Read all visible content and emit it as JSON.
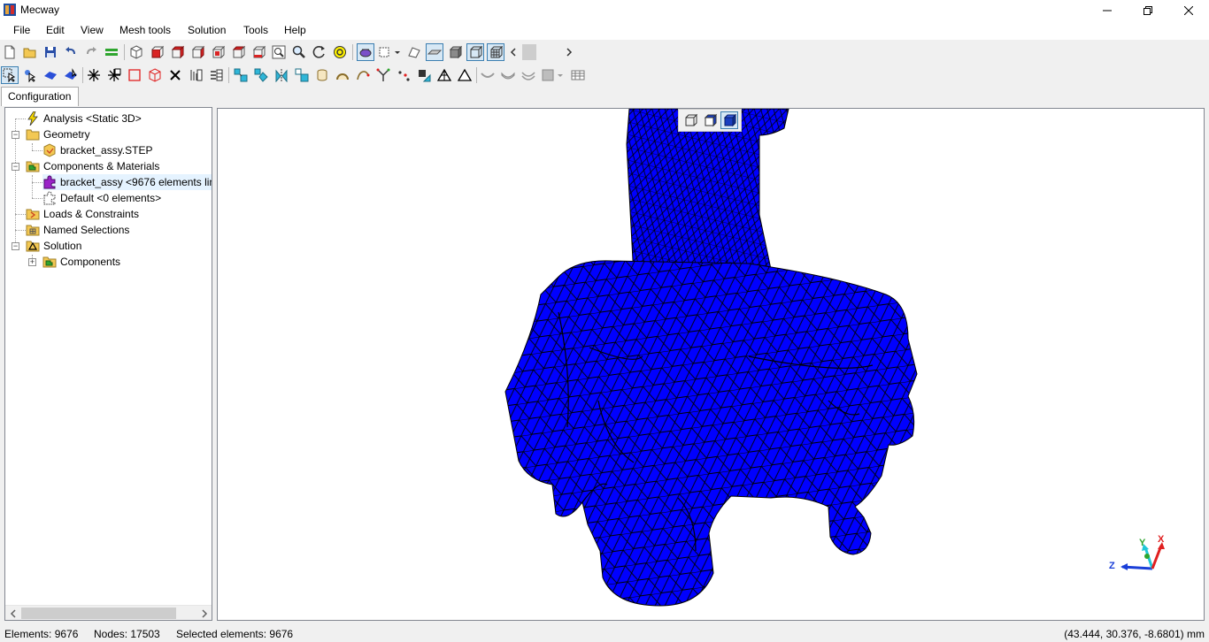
{
  "window": {
    "title": "Mecway"
  },
  "menu": [
    "File",
    "Edit",
    "View",
    "Mesh tools",
    "Solution",
    "Tools",
    "Help"
  ],
  "tabs": {
    "configuration": "Configuration"
  },
  "tree": {
    "analysis": "Analysis <Static 3D>",
    "geometry": "Geometry",
    "geometry_file": "bracket_assy.STEP",
    "components_materials": "Components & Materials",
    "component_bracket": "bracket_assy <9676 elements lin",
    "component_default": "Default <0 elements>",
    "loads_constraints": "Loads & Constraints",
    "named_selections": "Named Selections",
    "solution": "Solution",
    "solution_components": "Components"
  },
  "axis_triad": {
    "x": "X",
    "y": "Y",
    "z": "Z"
  },
  "status": {
    "elements": "Elements: 9676",
    "nodes": "Nodes: 17503",
    "selected": "Selected elements: 9676",
    "coordinates": "(43.444, 30.376, -8.6801) mm"
  },
  "colors": {
    "mesh_fill": "#0000ff",
    "mesh_edges": "#000000",
    "selection": "#e5f3ff",
    "pressed_button": "#d7e8f5"
  },
  "icons": {
    "toolbar1": [
      "new-file-icon",
      "open-folder-icon",
      "save-icon",
      "undo-icon",
      "redo-icon",
      "layers-icon",
      "iso-view-icon",
      "front-view-icon",
      "back-view-icon",
      "left-view-icon",
      "right-view-icon",
      "top-view-icon",
      "bottom-view-icon",
      "zoom-fit-icon",
      "zoom-icon",
      "rotate-icon",
      "pan-icon",
      "render-mode-icon",
      "display-options-icon",
      "shading-icon",
      "surface-icon",
      "solid-icon",
      "wireframe-icon",
      "mesh-lines-icon"
    ],
    "toolbar2": [
      "select-arrow-icon",
      "select-node-icon",
      "select-face-icon",
      "select-element-icon",
      "node-star-icon",
      "element-star-icon",
      "box-select-icon",
      "cube-select-icon",
      "delete-icon",
      "refine-icon",
      "split-icon",
      "extrude-icon",
      "revolve-icon",
      "mirror-icon",
      "move-icon",
      "cylinder-icon",
      "arc-icon",
      "curve-icon",
      "merge-icon",
      "nodes-icon",
      "convert-icon",
      "triangle-icon",
      "triangle-outline-icon",
      "surface-smooth-icon",
      "shell-icon",
      "shell-both-icon",
      "table-icon"
    ]
  }
}
